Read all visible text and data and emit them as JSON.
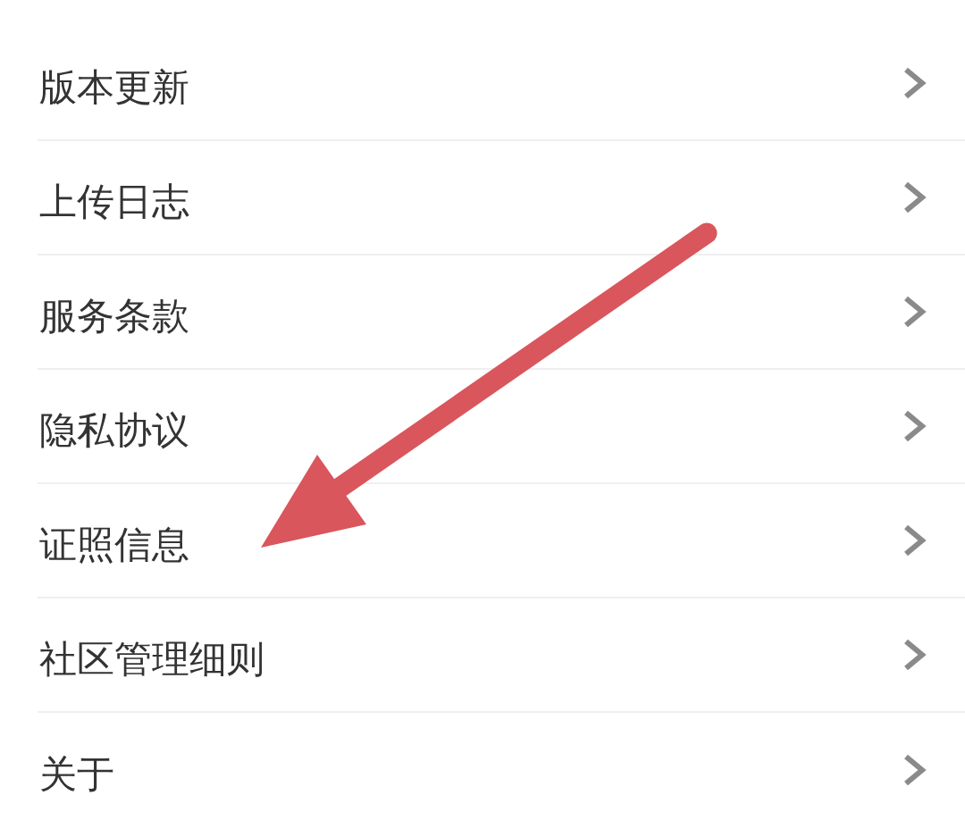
{
  "settings_list": {
    "items": [
      {
        "label": "版本更新"
      },
      {
        "label": "上传日志"
      },
      {
        "label": "服务条款"
      },
      {
        "label": "隐私协议"
      },
      {
        "label": "证照信息"
      },
      {
        "label": "社区管理细则"
      },
      {
        "label": "关于"
      }
    ]
  }
}
